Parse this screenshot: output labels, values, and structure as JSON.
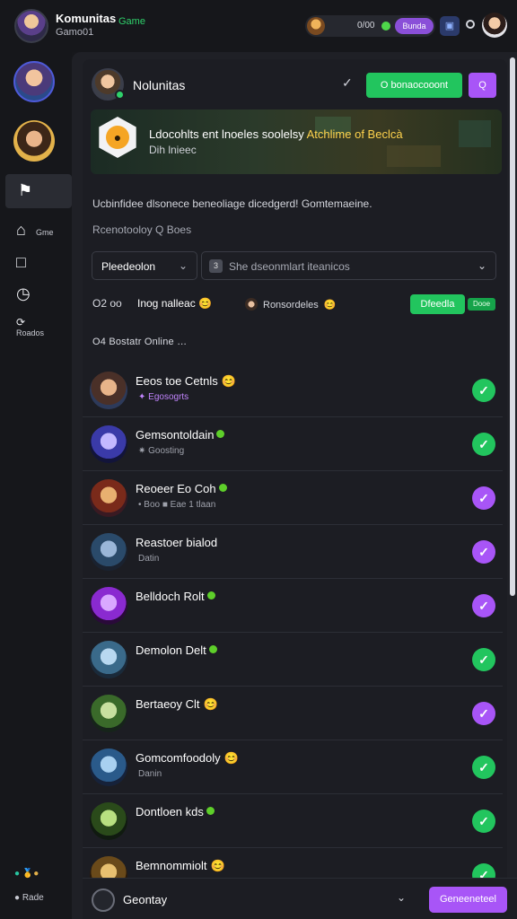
{
  "app": {
    "title": "Komunitas",
    "tag": "Game",
    "subtitle": "Gamo01"
  },
  "topbar": {
    "score": "0/00",
    "badge": "Bunda",
    "bell_icon": "controller-icon"
  },
  "rail": {
    "items": [
      {
        "icon": "home-icon",
        "label": "Gme"
      },
      {
        "icon": "square-icon",
        "label": ""
      },
      {
        "icon": "clock-icon",
        "label": ""
      },
      {
        "icon": "refresh-icon",
        "label": "Roados"
      }
    ],
    "footer1_a": "●",
    "footer1_b": "🥇●",
    "footer2": "Rade"
  },
  "header": {
    "name": "Nolunitas",
    "primary_button": "O bonaocooont",
    "secondary_button": "Q"
  },
  "banner": {
    "title_before": "Ldocohlts ent lnoeles soolelsy ",
    "title_highlight": "Atchlime of Beclcà",
    "subtitle": "Dih lnieec",
    "logo_glyph": "●"
  },
  "description": "Ucbinfidee dlsonece beneoliage dicedgerd! Gomtemaeine.",
  "description2": "Rcenotooloy Q Boes",
  "filters": {
    "select1": "Pleedeolon",
    "select2_badge": "3",
    "select2": "She dseonmlart iteanicos"
  },
  "tabs": {
    "a": "O2   oo",
    "b": "Inog nalleac",
    "b_emoji": "😊",
    "c": "Ronsordeles",
    "c_emoji": "😊",
    "green_pill": "Dfeedla",
    "green_pill2": "Dooe"
  },
  "section_title": "O4 Bostatr Online …",
  "friends": [
    {
      "name": "Eeos toe Cetnls",
      "emoji": "😊",
      "status": "✦ Egosogrts",
      "status_style": "purple",
      "check": "green",
      "avatar": [
        "#e8b48a",
        "#4a3028",
        "#2d3a5a"
      ]
    },
    {
      "name": "Gemsontoldain",
      "dot": true,
      "status": "✷ Goosting",
      "status_style": "",
      "check": "green",
      "avatar": [
        "#c3b8ff",
        "#3a3aa8",
        "#12143a"
      ]
    },
    {
      "name": "Reoeer Eo Coh",
      "dot": true,
      "status": "• Boo ■ Eae 1 tlaan",
      "status_style": "",
      "check": "purple",
      "avatar": [
        "#e8b070",
        "#7a2a1a",
        "#3a1a22"
      ]
    },
    {
      "name": "Reastoer bialod",
      "status": "Datin",
      "status_style": "",
      "check": "purple",
      "avatar": [
        "#9ab6d8",
        "#2a4a6a",
        "#1a2230"
      ]
    },
    {
      "name": "Belldoch Rolt",
      "dot": true,
      "status": "",
      "status_style": "",
      "check": "purple",
      "avatar": [
        "#d9a8ff",
        "#8a2ad0",
        "#2a0a3a"
      ]
    },
    {
      "name": "Demolon Delt",
      "dot": true,
      "status": "",
      "status_style": "",
      "check": "green",
      "avatar": [
        "#b8d8f0",
        "#3a6a8a",
        "#1a2a3a"
      ]
    },
    {
      "name": "Bertaeoy Clt",
      "emoji": "😊",
      "status": "",
      "status_style": "",
      "check": "purple",
      "avatar": [
        "#c8e0a0",
        "#3a6a2a",
        "#16241a"
      ]
    },
    {
      "name": "Gomcomfoodoly",
      "emoji": "😊",
      "status": "Danin",
      "status_style": "",
      "check": "green",
      "avatar": [
        "#a8d0f0",
        "#2a5a8a",
        "#16223a"
      ]
    },
    {
      "name": "Dontloen kds",
      "dot": true,
      "status": "",
      "status_style": "",
      "check": "green",
      "avatar": [
        "#b8e080",
        "#2a4a1a",
        "#101a10"
      ]
    },
    {
      "name": "Bemnommiolt",
      "emoji": "😊",
      "status": "",
      "status_style": "",
      "check": "green",
      "avatar": [
        "#e8c070",
        "#6a4a1a",
        "#2a1a0a"
      ]
    }
  ],
  "footer": {
    "text": "Geontay",
    "button": "Geneeneteel"
  }
}
